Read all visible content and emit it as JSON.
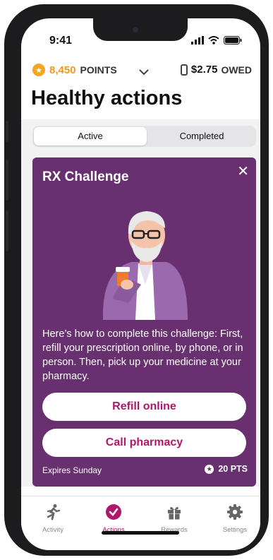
{
  "status": {
    "time": "9:41"
  },
  "header": {
    "points_value": "8,450",
    "points_label": "POINTS",
    "owed_amount": "$2.75",
    "owed_label": "OWED"
  },
  "page": {
    "title": "Healthy actions"
  },
  "segmented": {
    "active": "Active",
    "completed": "Completed"
  },
  "card": {
    "title": "RX Challenge",
    "description": "Here’s how to complete this challenge: First, refill your prescription online, by phone, or in person. Then, pick up your medicine at your pharmacy.",
    "btn_refill": "Refill online",
    "btn_call": "Call pharmacy",
    "expires": "Expires Sunday",
    "points": "20 PTS",
    "bg_color": "#68306f"
  },
  "tabs": [
    {
      "label": "Activity",
      "icon": "runner-icon"
    },
    {
      "label": "Actions",
      "icon": "check-circle-icon"
    },
    {
      "label": "Rewards",
      "icon": "gift-icon"
    },
    {
      "label": "Settings",
      "icon": "gear-icon"
    }
  ],
  "colors": {
    "accent": "#b0176a",
    "points": "#f39a1e"
  }
}
